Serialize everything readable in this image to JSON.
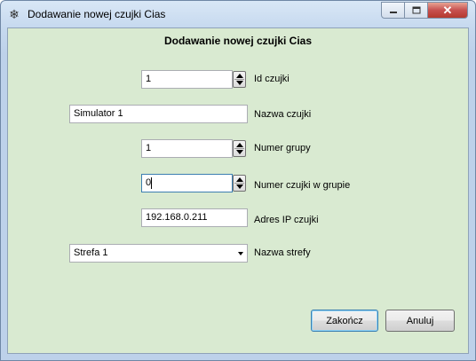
{
  "window": {
    "title": "Dodawanie nowej czujki Cias",
    "app_icon": "snowflake-icon",
    "controls": {
      "minimize": "minimize-icon",
      "maximize": "maximize-icon",
      "close": "close-icon"
    }
  },
  "form": {
    "heading": "Dodawanie nowej czujki Cias",
    "id": {
      "value": "1",
      "label": "Id czujki"
    },
    "name": {
      "value": "Simulator 1",
      "label": "Nazwa czujki"
    },
    "group": {
      "value": "1",
      "label": "Numer grupy"
    },
    "number_in_group": {
      "value": "0",
      "label": "Numer czujki w grupie"
    },
    "ip": {
      "value": "192.168.0.211",
      "label": "Adres IP czujki"
    },
    "zone": {
      "value": "Strefa 1",
      "label": "Nazwa strefy"
    }
  },
  "buttons": {
    "finish": "Zakończ",
    "cancel": "Anuluj"
  }
}
